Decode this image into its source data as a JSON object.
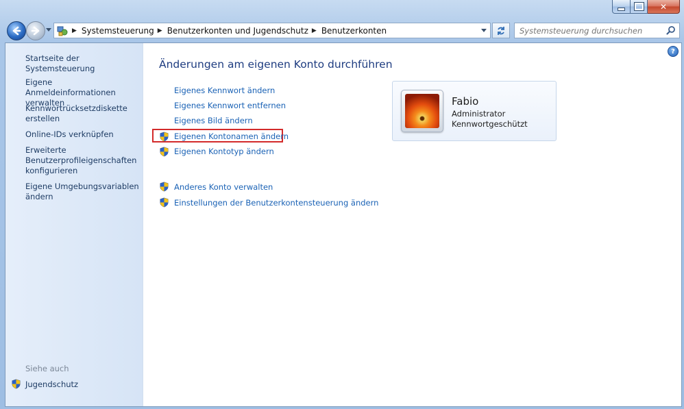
{
  "window": {
    "minimize_glyph": "▁",
    "maximize_glyph": "□",
    "close_glyph": "✕"
  },
  "addressbar": {
    "crumbs": [
      "Systemsteuerung",
      "Benutzerkonten und Jugendschutz",
      "Benutzerkonten"
    ]
  },
  "search": {
    "placeholder": "Systemsteuerung durchsuchen"
  },
  "sidebar": {
    "items": [
      {
        "label": "Startseite der Systemsteuerung"
      },
      {
        "label": "Eigene Anmeldeinformationen verwalten"
      },
      {
        "label": "Kennwortrücksetzdiskette erstellen"
      },
      {
        "label": "Online-IDs verknüpfen"
      },
      {
        "label": "Erweiterte Benutzerprofileigenschaften konfigurieren"
      },
      {
        "label": "Eigene Umgebungsvariablen ändern"
      }
    ],
    "see_also": "Siehe auch",
    "see_also_items": [
      {
        "label": "Jugendschutz",
        "icon": "shield-icon"
      }
    ]
  },
  "main": {
    "heading": "Änderungen am eigenen Konto durchführen",
    "tasks": [
      {
        "label": "Eigenes Kennwort ändern"
      },
      {
        "label": "Eigenes Kennwort entfernen"
      },
      {
        "label": "Eigenes Bild ändern"
      },
      {
        "label": "Eigenen Kontonamen ändern",
        "icon": "shield-icon"
      },
      {
        "label": "Eigenen Kontotyp ändern",
        "icon": "shield-icon"
      }
    ],
    "other_tasks": [
      {
        "label": "Anderes Konto verwalten",
        "icon": "shield-icon"
      },
      {
        "label": "Einstellungen der Benutzerkontensteuerung ändern",
        "icon": "shield-icon"
      }
    ]
  },
  "account": {
    "name": "Fabio",
    "type": "Administrator",
    "password_status": "Kennwortgeschützt"
  },
  "help": {
    "glyph": "?"
  },
  "colors": {
    "link": "#1a62b5",
    "heading": "#1e3c80",
    "highlight": "#d32a2a"
  }
}
